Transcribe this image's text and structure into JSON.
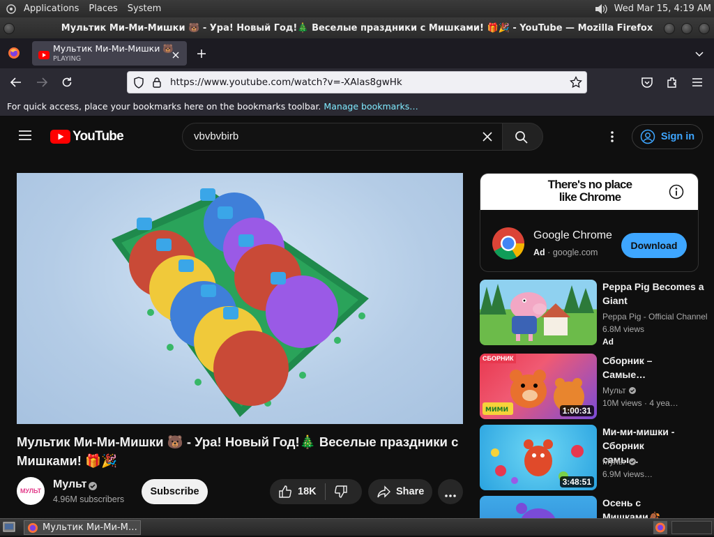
{
  "panel": {
    "menus": [
      "Applications",
      "Places",
      "System"
    ],
    "clock": "Wed Mar 15,  4:19 AM"
  },
  "window": {
    "title": "Мультик Ми-Ми-Мишки 🐻 - Ура! Новый Год!🎄 Веселые праздники с Мишками! 🎁🎉 - YouTube — Mozilla Firefox"
  },
  "browser": {
    "tab": {
      "title": "Мультик Ми-Ми-Мишки 🐻",
      "status": "PLAYING"
    },
    "url": "https://www.youtube.com/watch?v=-XAlas8gwHk",
    "bookmarks_hint": "For quick access, place your bookmarks here on the bookmarks toolbar.",
    "bookmarks_link": "Manage bookmarks…"
  },
  "youtube": {
    "logo_text": "YouTube",
    "search_value": "vbvbvbirb",
    "signin_label": "Sign in",
    "video": {
      "title": "Мультик Ми-Ми-Мишки 🐻 - Ура! Новый Год!🎄 Веселые праздники с Мишками! 🎁🎉",
      "channel": "Мульт",
      "subscribers": "4.96M subscribers",
      "subscribe_label": "Subscribe",
      "likes": "18K",
      "share_label": "Share",
      "avatar_text": "МУЛЬТ"
    },
    "ad": {
      "banner_line1": "There's no place",
      "banner_line2": "like Chrome",
      "title": "Google Chrome",
      "ad_label": "Ad",
      "domain": "google.com",
      "cta": "Download"
    },
    "recommendations": [
      {
        "title": "Peppa Pig Becomes a Giant",
        "channel": "Peppa Pig - Official Channel",
        "views": "6.8M views",
        "extra": "Ad",
        "duration": ""
      },
      {
        "title": "Сборник – Самые…",
        "channel": "Мульт",
        "views": "10M views",
        "extra": "4 yea…",
        "duration": "1:00:31",
        "badge": "СБОРНИК"
      },
      {
        "title": "Ми-ми-мишки - Сборник самы…",
        "channel": "Мульт",
        "views": "6.9M views…",
        "extra": "",
        "duration": "3:48:51"
      },
      {
        "title": "Осень с Мишками🍂",
        "channel": "",
        "views": "",
        "extra": "",
        "duration": ""
      }
    ]
  },
  "taskbar": {
    "window_label": "Мультик Ми-Ми-М…"
  }
}
